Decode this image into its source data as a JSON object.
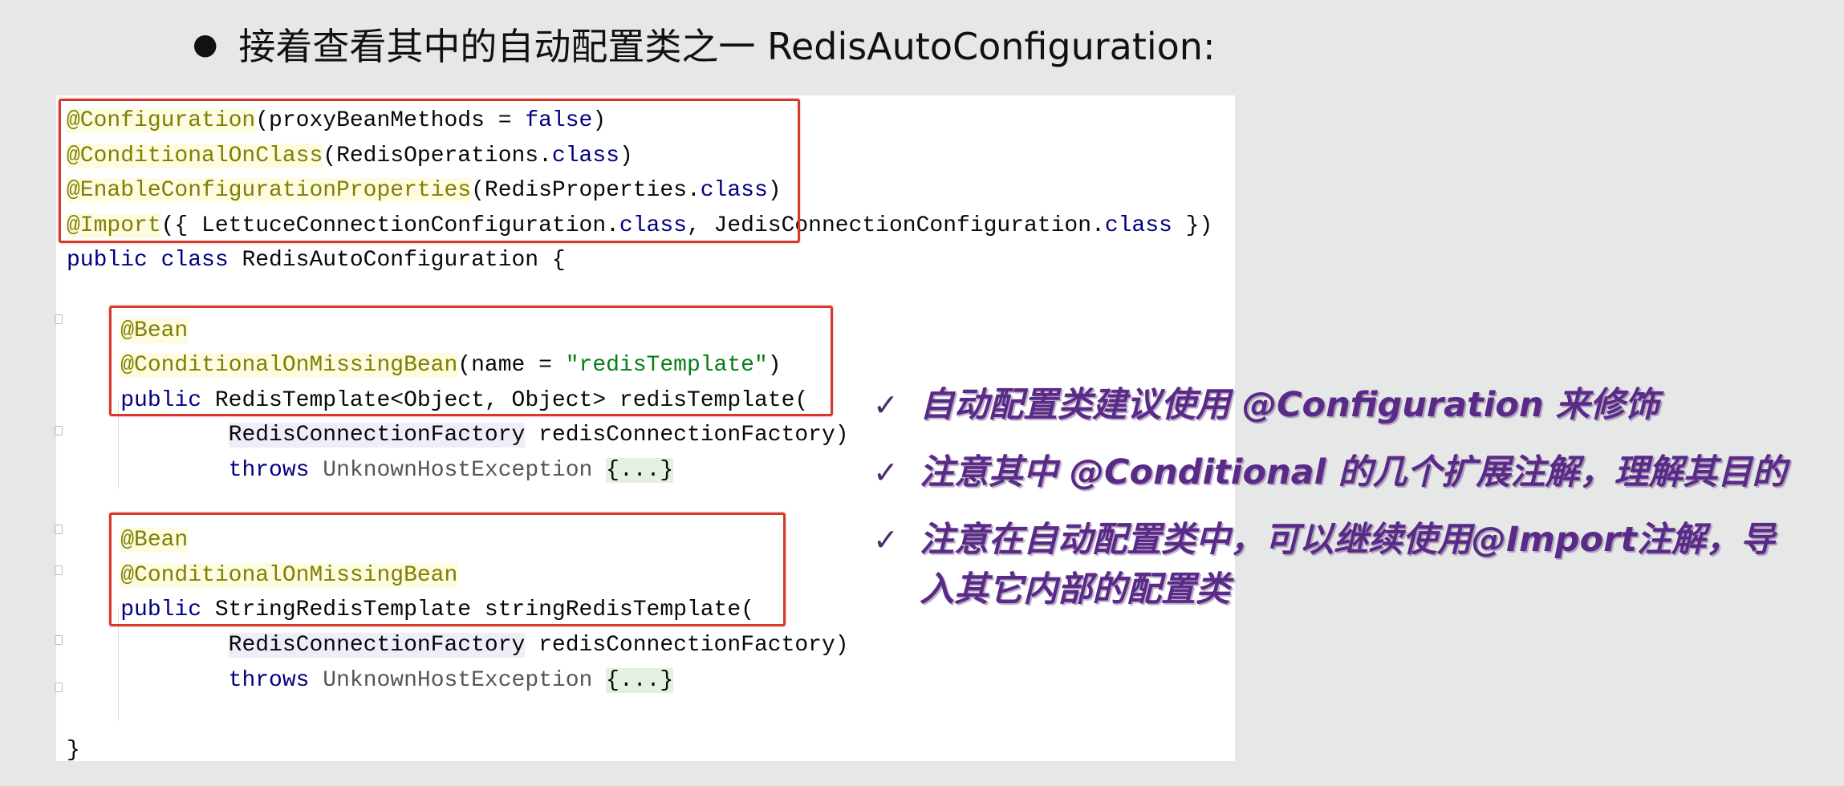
{
  "slide": {
    "bullet": "●",
    "title": "接着查看其中的自动配置类之一 RedisAutoConfiguration:"
  },
  "code": {
    "lines": [
      [
        {
          "t": "@Configuration",
          "c": "ann"
        },
        {
          "t": "(proxyBeanMethods = "
        },
        {
          "t": "false",
          "c": "kw"
        },
        {
          "t": ")"
        }
      ],
      [
        {
          "t": "@ConditionalOnClass",
          "c": "ann"
        },
        {
          "t": "(RedisOperations."
        },
        {
          "t": "class",
          "c": "kw"
        },
        {
          "t": ")"
        }
      ],
      [
        {
          "t": "@EnableConfigurationProperties",
          "c": "ann"
        },
        {
          "t": "(RedisProperties."
        },
        {
          "t": "class",
          "c": "kw"
        },
        {
          "t": ")"
        }
      ],
      [
        {
          "t": "@Import",
          "c": "ann"
        },
        {
          "t": "({ LettuceConnectionConfiguration."
        },
        {
          "t": "class",
          "c": "kw"
        },
        {
          "t": ", JedisConnectionConfiguration."
        },
        {
          "t": "class",
          "c": "kw"
        },
        {
          "t": " })"
        }
      ],
      [
        {
          "t": "public class",
          "c": "kw"
        },
        {
          "t": " RedisAutoConfiguration {"
        }
      ],
      [],
      [
        {
          "t": "    "
        },
        {
          "t": "@Bean",
          "c": "ann"
        }
      ],
      [
        {
          "t": "    "
        },
        {
          "t": "@ConditionalOnMissingBean",
          "c": "ann"
        },
        {
          "t": "(name = "
        },
        {
          "t": "\"redisTemplate\"",
          "c": "str"
        },
        {
          "t": ")"
        }
      ],
      [
        {
          "t": "    "
        },
        {
          "t": "public",
          "c": "kw"
        },
        {
          "t": " RedisTemplate<Object, Object> redisTemplate("
        }
      ],
      [
        {
          "t": "            "
        },
        {
          "t": "RedisConnectionFactory",
          "c": "ptype"
        },
        {
          "t": " redisConnectionFactory)"
        }
      ],
      [
        {
          "t": "            "
        },
        {
          "t": "throws",
          "c": "kw"
        },
        {
          "t": " "
        },
        {
          "t": "UnknownHostException",
          "c": "muted"
        },
        {
          "t": " "
        },
        {
          "t": "{...}",
          "c": "fold"
        }
      ],
      [],
      [
        {
          "t": "    "
        },
        {
          "t": "@Bean",
          "c": "ann"
        }
      ],
      [
        {
          "t": "    "
        },
        {
          "t": "@ConditionalOnMissingBean",
          "c": "ann"
        }
      ],
      [
        {
          "t": "    "
        },
        {
          "t": "public",
          "c": "kw"
        },
        {
          "t": " StringRedisTemplate stringRedisTemplate("
        }
      ],
      [
        {
          "t": "            "
        },
        {
          "t": "RedisConnectionFactory",
          "c": "ptype"
        },
        {
          "t": " redisConnectionFactory)"
        }
      ],
      [
        {
          "t": "            "
        },
        {
          "t": "throws",
          "c": "kw"
        },
        {
          "t": " "
        },
        {
          "t": "UnknownHostException",
          "c": "muted"
        },
        {
          "t": " "
        },
        {
          "t": "{...}",
          "c": "fold"
        }
      ],
      [],
      [
        {
          "t": "}"
        }
      ]
    ]
  },
  "notes": {
    "check": "✓",
    "items": [
      "自动配置类建议使用 @Configuration 来修饰",
      "注意其中 @Conditional 的几个扩展注解，理解其目的",
      "注意在自动配置类中，可以继续使用@Import注解，导入其它内部的配置类"
    ]
  },
  "colors": {
    "annotation": "#808000",
    "keyword": "#000080",
    "string": "#067d17",
    "highlight_box": "#d33a2c",
    "note_text": "#5a2a88"
  }
}
